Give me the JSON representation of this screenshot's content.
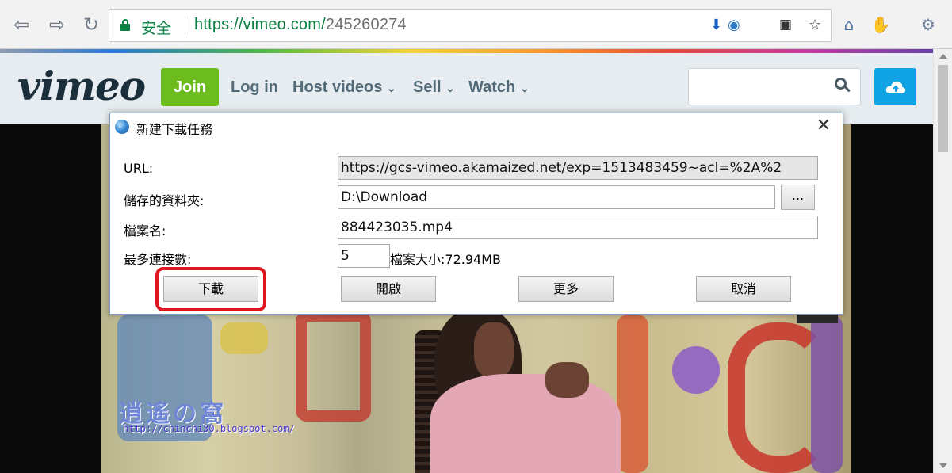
{
  "browser": {
    "secure_label": "安全",
    "url_host": "https://vimeo.com/",
    "url_path": "245260274"
  },
  "site": {
    "logo": "vimeo",
    "join_label": "Join",
    "nav": [
      {
        "label": "Log in"
      },
      {
        "label": "Host videos"
      },
      {
        "label": "Sell"
      },
      {
        "label": "Watch"
      }
    ]
  },
  "dialog": {
    "title": "新建下載任務",
    "url_label": "URL:",
    "url_value": "https://gcs-vimeo.akamaized.net/exp=1513483459~acl=%2A%2",
    "folder_label": "儲存的資料夾:",
    "folder_value": "D:\\Download",
    "browse_label": "...",
    "filename_label": "檔案名:",
    "filename_value": "884423035.mp4",
    "connections_label": "最多連接數:",
    "connections_value": "5",
    "filesize": "檔案大小:72.94MB",
    "buttons": {
      "download": "下載",
      "open": "開啟",
      "more": "更多",
      "cancel": "取消"
    }
  },
  "watermark": {
    "text": "逍遙の窩",
    "url": "http://chinchi30.blogspot.com/"
  },
  "colors": {
    "vimeo_green": "#6dbc1d",
    "vimeo_blue": "#10a4e4",
    "secure_green": "#0b8043",
    "highlight_red": "#e0161f"
  }
}
